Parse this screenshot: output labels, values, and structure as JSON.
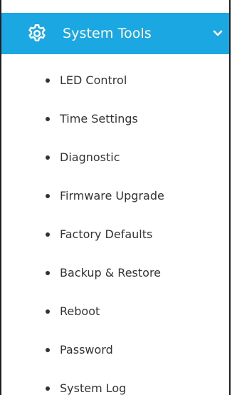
{
  "menu": {
    "title": "System Tools",
    "icon": "gear-icon",
    "expand_icon": "chevron-down-icon",
    "colors": {
      "header_bg": "#1ba7e1",
      "header_text": "#ffffff",
      "item_text": "#333333"
    },
    "items": [
      {
        "label": "LED Control"
      },
      {
        "label": "Time Settings"
      },
      {
        "label": "Diagnostic"
      },
      {
        "label": "Firmware Upgrade"
      },
      {
        "label": "Factory Defaults"
      },
      {
        "label": "Backup & Restore"
      },
      {
        "label": "Reboot"
      },
      {
        "label": "Password"
      },
      {
        "label": "System Log"
      }
    ]
  }
}
